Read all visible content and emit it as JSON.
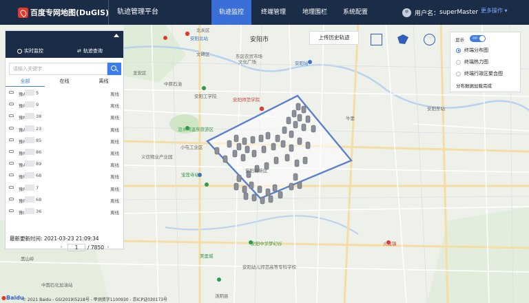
{
  "header": {
    "logo_text": "百度专网地图(DuGIS)",
    "app_title": "轨迹管理平台",
    "nav": [
      "轨迹监控",
      "终端管理",
      "地理围栏",
      "系统配置"
    ],
    "active_nav": "轨迹监控",
    "user_label": "用户名：",
    "user_name": "superMaster",
    "more_label": "更多操作"
  },
  "left_panel": {
    "tabs": [
      "实时监控",
      "轨迹查询"
    ],
    "search_placeholder": "请输入关键字",
    "filters": [
      "全部",
      "在线",
      "离线"
    ],
    "active_filter": "全部",
    "rows": [
      {
        "name": "豫A",
        "id": "5",
        "status": "离线"
      },
      {
        "name": "豫R",
        "id": "9",
        "status": "离线"
      },
      {
        "name": "豫N",
        "id": "38",
        "status": "离线"
      },
      {
        "name": "豫A",
        "id": "23",
        "status": "离线"
      },
      {
        "name": "豫R",
        "id": "85",
        "status": "离线"
      },
      {
        "name": "豫N",
        "id": "86",
        "status": "离线"
      },
      {
        "name": "豫A",
        "id": "89",
        "status": "离线"
      },
      {
        "name": "豫F",
        "id": "68",
        "status": "离线"
      },
      {
        "name": "豫F",
        "id": "7",
        "status": "离线"
      },
      {
        "name": "豫F",
        "id": "68",
        "status": "离线"
      },
      {
        "name": "豫I",
        "id": "36",
        "status": "离线"
      }
    ],
    "updated_label": "最新更新时间:",
    "updated_time": "2021-03-23 21:09:34",
    "page_current": "1",
    "page_total": "/ 7850"
  },
  "tools": {
    "upload_label": "上传历史轨迹",
    "draw_tools": [
      "rectangle-tool-icon",
      "polygon-tool-icon",
      "circle-tool-icon"
    ]
  },
  "display_panel": {
    "label": "显示",
    "toggle_text": "on",
    "options": [
      "终端分布图",
      "终端热力图",
      "终端行政区聚合图"
    ],
    "selected": "终端分布图",
    "status": "分布数据加载完成"
  },
  "map": {
    "labels": {
      "anyang": "安阳市",
      "beiguan": "北关区",
      "wenfeng": "文峰区",
      "longan": "龙安区",
      "yindu": "殷都区",
      "xiaotun": "小屯工业区",
      "anyang_north": "安阳北站",
      "anyang_east": "安阳东站",
      "anyang_station": "安阳站",
      "zhongyuan_oil": "中原石油",
      "anyang_edu": "安阳师范学院",
      "dongqu": "东区农贸市场",
      "wenhua": "文化广场",
      "zhangwu": "张武庄",
      "lize": "李则",
      "anyang_univ": "安阳工学院",
      "huanhe": "洹水湾温泉旅游区",
      "yige": "义信物业产业园",
      "baoying": "宝莲寺站",
      "tangdu": "汤都",
      "erheshan": "二郎山庄",
      "anyang_hi": "安阳高新区",
      "niuli": "牛里",
      "anyang_zm": "安阳中华梦幻谷",
      "anyang_kindergarten": "安阳幼儿师范高等专科学校",
      "meili": "美里城",
      "huolong": "火龙镇",
      "tangyin": "汤阴县",
      "zhongguo": "中国石化加油站",
      "heishan": "黑山岭",
      "anyang_bus": "安阳东客站"
    }
  },
  "footer": {
    "logo": "Baidu",
    "copyright": "© 2021 Baidu - GS(2019)5218号 - 甲测资字1100930 - 京ICP证030173号"
  },
  "colors": {
    "header_bg": "#1b2c47",
    "accent": "#3a6ed9",
    "polygon": "#5a7fd0"
  }
}
